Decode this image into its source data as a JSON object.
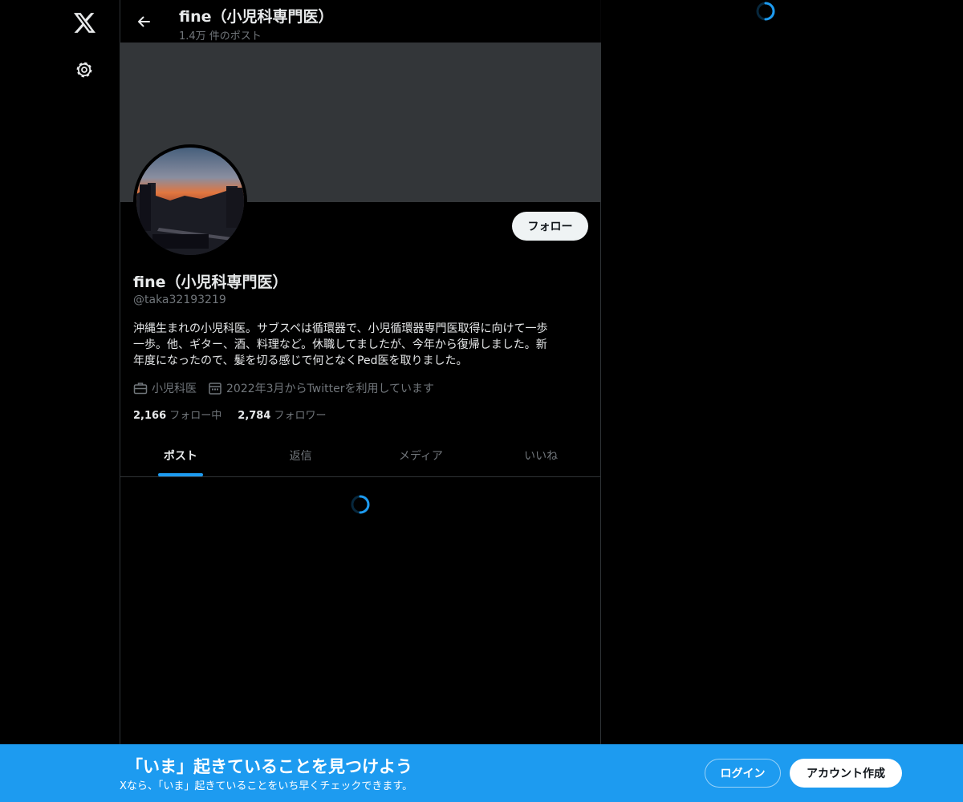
{
  "rail": {
    "logo_icon": "x-logo-icon",
    "settings_icon": "gear-icon"
  },
  "header": {
    "name": "fine（小児科専門医）",
    "post_count": "1.4万 件のポスト"
  },
  "profile": {
    "name": "fine（小児科専門医）",
    "handle": "@taka32193219",
    "follow_label": "フォロー",
    "bio_lines": [
      "沖縄生まれの小児科医。サブスペは循環器で、小児循環器専門医取得に向けて一歩",
      "一歩。他、ギター、酒、料理など。休職してましたが、今年から復帰しました。新",
      "年度になったので、髪を切る感じで何となくPed医を取りました。"
    ],
    "profession": "小児科医",
    "joined": "2022年3月からTwitterを利用しています",
    "following_count": "2,166",
    "following_label": "フォロー中",
    "followers_count": "2,784",
    "followers_label": "フォロワー"
  },
  "tabs": [
    {
      "label": "ポスト",
      "active": true
    },
    {
      "label": "返信",
      "active": false
    },
    {
      "label": "メディア",
      "active": false
    },
    {
      "label": "いいね",
      "active": false
    }
  ],
  "bottom_bar": {
    "title": "「いま」起きていることを見つけよう",
    "subtitle": "Xなら、「いま」起きていることをいち早くチェックできます。",
    "login_label": "ログイン",
    "signup_label": "アカウント作成"
  },
  "colors": {
    "accent": "#1d9bf0",
    "background": "#000000",
    "banner": "#333639",
    "muted_text": "#71767b"
  }
}
